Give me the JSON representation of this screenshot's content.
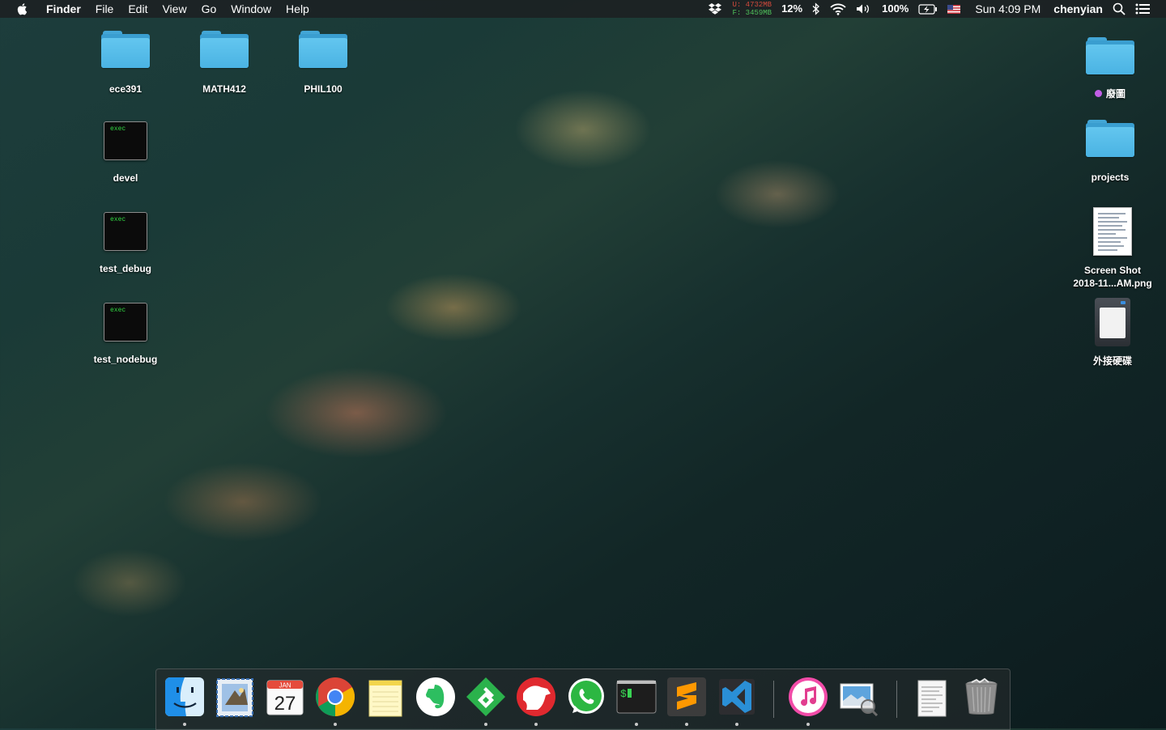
{
  "menubar": {
    "app_name": "Finder",
    "menus": [
      "File",
      "Edit",
      "View",
      "Go",
      "Window",
      "Help"
    ],
    "memory_used": "U: 4732MB",
    "memory_free": "F: 3459MB",
    "cpu": "12%",
    "battery": "100%",
    "clock": "Sun 4:09 PM",
    "user": "chenyian",
    "colors": {
      "memory_used": "#d24a3c",
      "memory_free": "#4fc25b"
    }
  },
  "desktop": {
    "left_icons": [
      {
        "label": "ece391",
        "kind": "folder"
      },
      {
        "label": "MATH412",
        "kind": "folder"
      },
      {
        "label": "PHIL100",
        "kind": "folder"
      },
      {
        "label": "devel",
        "kind": "exec",
        "badge": "exec"
      },
      {
        "label": "test_debug",
        "kind": "exec",
        "badge": "exec"
      },
      {
        "label": "test_nodebug",
        "kind": "exec",
        "badge": "exec"
      }
    ],
    "right_icons": [
      {
        "label": "廢圖",
        "kind": "folder",
        "tag_color": "#c25ee6"
      },
      {
        "label": "projects",
        "kind": "folder"
      },
      {
        "label_line1": "Screen Shot",
        "label_line2": "2018-11...AM.png",
        "kind": "image"
      },
      {
        "label": "外接硬碟",
        "kind": "external-drive"
      }
    ]
  },
  "dock": {
    "apps": [
      {
        "name": "Finder",
        "icon": "finder-icon",
        "running": true
      },
      {
        "name": "Mail",
        "icon": "mail-icon",
        "running": false
      },
      {
        "name": "Calendar",
        "icon": "calendar-icon",
        "running": false,
        "month": "JAN",
        "day": "27"
      },
      {
        "name": "Google Chrome",
        "icon": "chrome-icon",
        "running": true
      },
      {
        "name": "Notes",
        "icon": "notes-icon",
        "running": false
      },
      {
        "name": "Evernote",
        "icon": "evernote-icon",
        "running": false
      },
      {
        "name": "Feedly",
        "icon": "feedly-icon",
        "running": true
      },
      {
        "name": "Bear",
        "icon": "bear-icon",
        "running": true
      },
      {
        "name": "WhatsApp",
        "icon": "whatsapp-icon",
        "running": false
      },
      {
        "name": "Terminal",
        "icon": "terminal-icon",
        "running": true,
        "prompt": "$"
      },
      {
        "name": "Sublime Text",
        "icon": "sublime-icon",
        "running": true
      },
      {
        "name": "Visual Studio Code",
        "icon": "vscode-icon",
        "running": true
      },
      {
        "name": "iTunes",
        "icon": "itunes-icon",
        "running": true
      },
      {
        "name": "Preview",
        "icon": "preview-icon",
        "running": false
      },
      {
        "name": "Documents",
        "icon": "document-stack-icon",
        "running": false
      },
      {
        "name": "Trash",
        "icon": "trash-icon",
        "running": false
      }
    ]
  }
}
